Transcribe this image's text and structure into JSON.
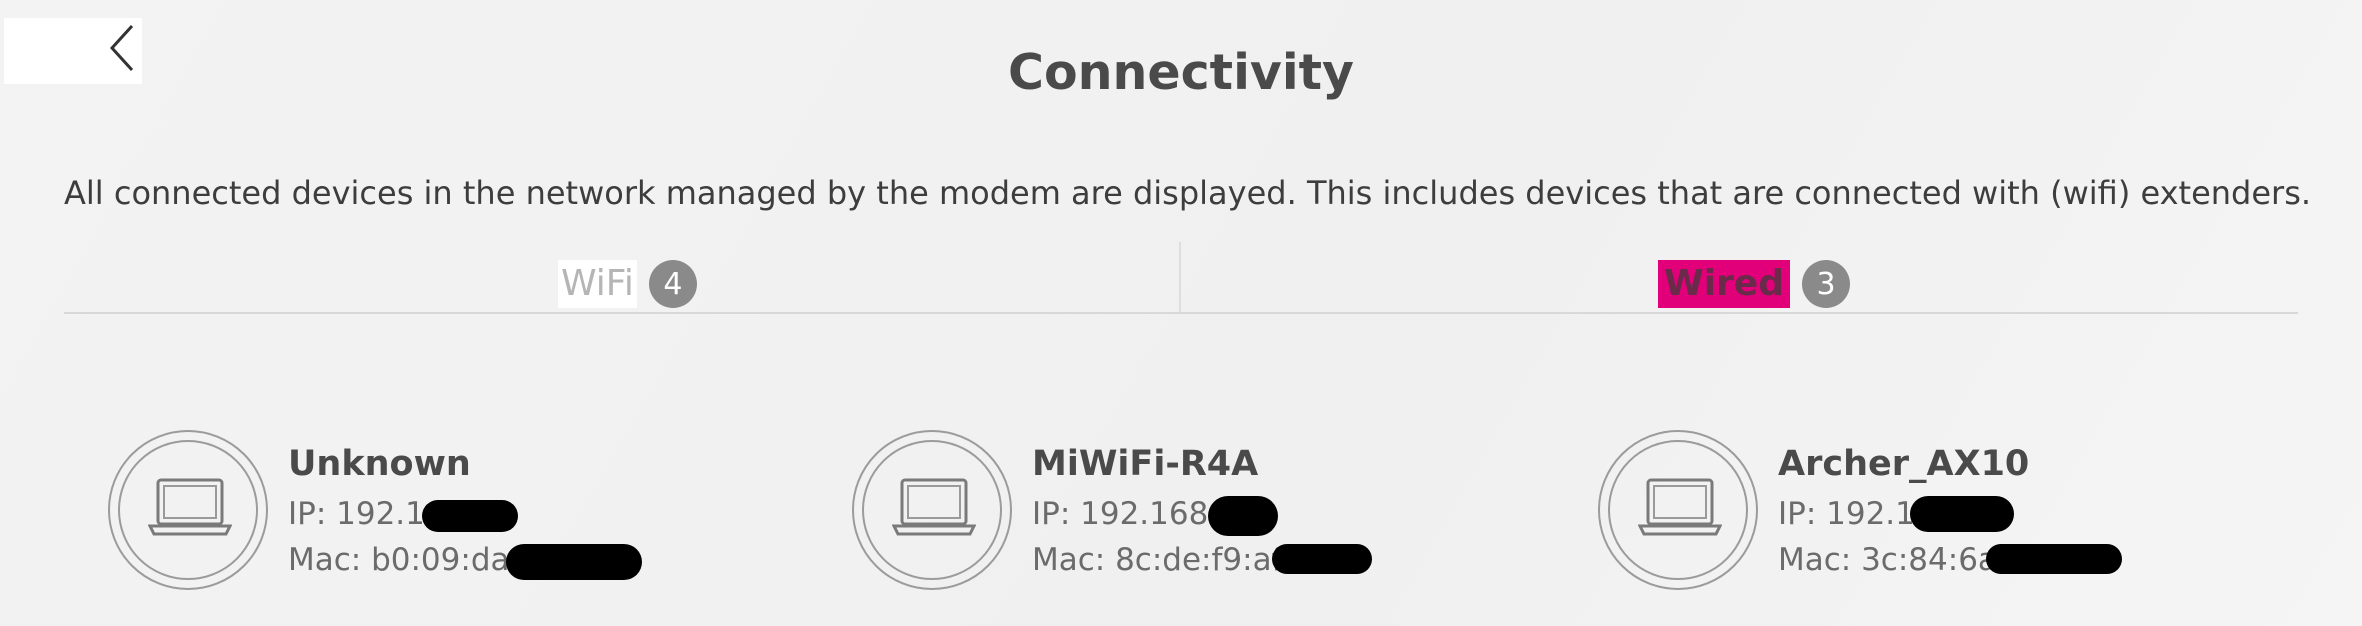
{
  "header": {
    "title": "Connectivity",
    "back_icon": "chevron-left-icon"
  },
  "description": "All connected devices in the network managed by the modem are displayed. This includes devices that are connected with (wifi) extenders.",
  "tabs": [
    {
      "label": "WiFi",
      "count": "4",
      "selected": false
    },
    {
      "label": "Wired",
      "count": "3",
      "selected": true
    }
  ],
  "colors": {
    "accent": "#e2007a",
    "badge": "#8a8a8a",
    "text": "#4a4a4a"
  },
  "devices": [
    {
      "name": "Unknown",
      "ip": "IP: 192.16",
      "mac": "Mac: b0:09:da:",
      "icon": "laptop-icon"
    },
    {
      "name": "MiWiFi-R4A",
      "ip": "IP: 192.168.1",
      "mac": "Mac: 8c:de:f9:af",
      "icon": "laptop-icon"
    },
    {
      "name": "Archer_AX10",
      "ip": "IP: 192.16",
      "mac": "Mac: 3c:84:6a:",
      "icon": "laptop-icon"
    }
  ]
}
